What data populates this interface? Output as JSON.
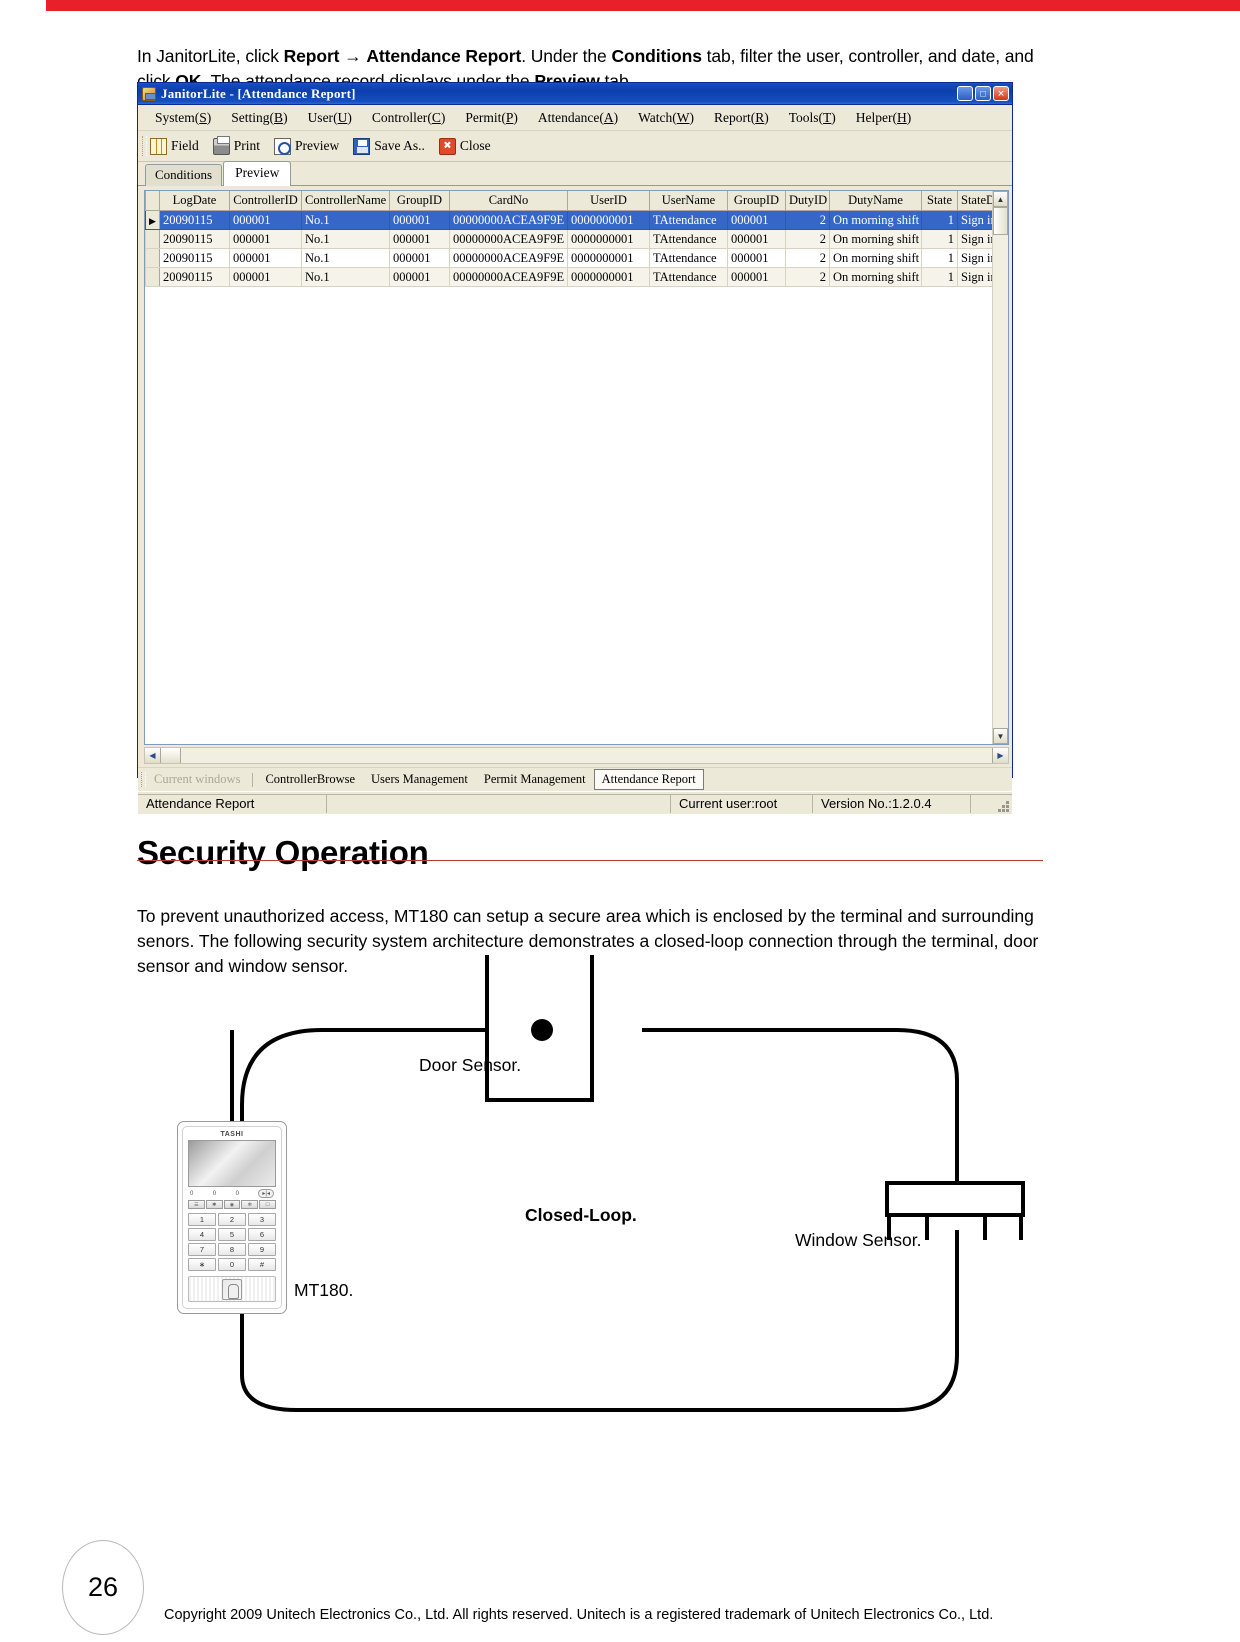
{
  "intro": {
    "seg1": "In JanitorLite, click ",
    "b1": "Report",
    "arrow": " → ",
    "b2": "Attendance Report",
    "seg2": ". Under the ",
    "b3": "Conditions",
    "seg3": " tab, filter the user, controller, and date, and click ",
    "b4": "OK",
    "seg4": ". The attendance record displays under the ",
    "b5": "Preview",
    "seg5": " tab."
  },
  "app": {
    "title": "JanitorLite - [Attendance Report]",
    "window_buttons": {
      "minimize": "_",
      "maximize": "□",
      "close": "✕"
    },
    "menus": [
      {
        "label": "System",
        "key": "S"
      },
      {
        "label": "Setting",
        "key": "B"
      },
      {
        "label": "User",
        "key": "U"
      },
      {
        "label": "Controller",
        "key": "C"
      },
      {
        "label": "Permit",
        "key": "P"
      },
      {
        "label": "Attendance",
        "key": "A"
      },
      {
        "label": "Watch",
        "key": "W"
      },
      {
        "label": "Report",
        "key": "R"
      },
      {
        "label": "Tools",
        "key": "T"
      },
      {
        "label": "Helper",
        "key": "H"
      }
    ],
    "toolbar": [
      {
        "label": "Field",
        "icon": "grid-icon"
      },
      {
        "label": "Print",
        "icon": "printer-icon"
      },
      {
        "label": "Preview",
        "icon": "magnifier-icon"
      },
      {
        "label": "Save As..",
        "icon": "floppy-icon"
      },
      {
        "label": "Close",
        "icon": "close-box-icon"
      }
    ],
    "tabs": [
      {
        "label": "Conditions",
        "active": false
      },
      {
        "label": "Preview",
        "active": true
      }
    ],
    "grid": {
      "columns": [
        "LogDate",
        "ControllerID",
        "ControllerName",
        "GroupID",
        "CardNo",
        "UserID",
        "UserName",
        "GroupID",
        "DutyID",
        "DutyName",
        "State",
        "StateDe"
      ],
      "rows": [
        {
          "selected": true,
          "cells": [
            "20090115",
            "000001",
            "No.1",
            "000001",
            "00000000ACEA9F9E",
            "0000000001",
            "TAttendance",
            "000001",
            "2",
            "On morning shift",
            "1",
            "Sign in"
          ]
        },
        {
          "selected": false,
          "cells": [
            "20090115",
            "000001",
            "No.1",
            "000001",
            "00000000ACEA9F9E",
            "0000000001",
            "TAttendance",
            "000001",
            "2",
            "On morning shift",
            "1",
            "Sign in"
          ]
        },
        {
          "selected": false,
          "cells": [
            "20090115",
            "000001",
            "No.1",
            "000001",
            "00000000ACEA9F9E",
            "0000000001",
            "TAttendance",
            "000001",
            "2",
            "On morning shift",
            "1",
            "Sign in"
          ]
        },
        {
          "selected": false,
          "cells": [
            "20090115",
            "000001",
            "No.1",
            "000001",
            "00000000ACEA9F9E",
            "0000000001",
            "TAttendance",
            "000001",
            "2",
            "On morning shift",
            "1",
            "Sign in"
          ]
        }
      ],
      "row_marker": "▶"
    },
    "window_bar": {
      "label": "Current windows",
      "items": [
        "ControllerBrowse",
        "Users Management",
        "Permit Management",
        "Attendance Report"
      ],
      "active": "Attendance Report"
    },
    "status_bar": {
      "left": "Attendance Report",
      "user": "Current user:root",
      "version": "Version No.:1.2.0.4"
    },
    "scroll": {
      "up": "▲",
      "down": "▼",
      "left": "◀",
      "right": "▶"
    }
  },
  "section": {
    "heading": "Security Operation",
    "paragraph": "To prevent unauthorized access, MT180 can setup a secure area which is enclosed by the terminal and surrounding senors. The following security system architecture demonstrates a closed-loop connection through the terminal, door sensor and window sensor."
  },
  "diagram": {
    "labels": {
      "door_sensor": "Door Sensor.",
      "closed_loop": "Closed-Loop.",
      "window_sensor": "Window Sensor.",
      "mt180": "MT180."
    },
    "device": {
      "brand": "TASHI",
      "indicator_digits": [
        "0",
        "0",
        "0"
      ],
      "indicator_pill": "▸|◂",
      "function_keys": [
        "☰",
        "✱",
        "◉",
        "✻",
        "☐"
      ],
      "keypad": [
        "1",
        "2",
        "3",
        "4",
        "5",
        "6",
        "7",
        "8",
        "9",
        "∗",
        "0",
        "#"
      ]
    }
  },
  "footer": {
    "page_number": "26",
    "copyright": "Copyright 2009 Unitech Electronics Co., Ltd. All rights reserved. Unitech is a registered trademark of Unitech Electronics Co., Ltd."
  },
  "colors": {
    "accent_red": "#e8202a",
    "rule_red": "#c0392b",
    "titlebar_blue": "#0c3fae",
    "selection_blue": "#3566c8"
  }
}
